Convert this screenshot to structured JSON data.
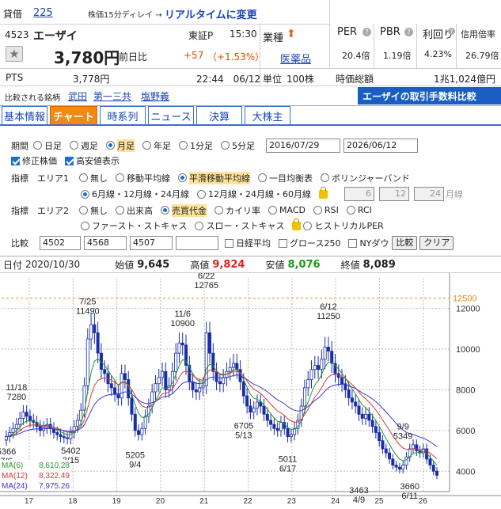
{
  "quote": {
    "lending_tag": "貸借",
    "lending_value": "225",
    "delay_note": "株価15分ディレイ →",
    "realtime_link": "リアルタイムに変更",
    "code": "4523",
    "name": "エーザイ",
    "market": "東証P",
    "time": "15:30",
    "price": "3,780円",
    "prev_label": "前日比",
    "change": "+57",
    "change_pct": "（+1.53%）",
    "pts_label": "PTS",
    "pts_price": "3,778円",
    "pts_datetime": "22:44　06/12",
    "compare_label": "比較される銘柄",
    "compare_1": "武田",
    "compare_2": "第一三共",
    "compare_3": "塩野義",
    "sector_label": "業種",
    "sector_value": "医薬品",
    "unit_label": "単位",
    "unit_value": "100株",
    "per_label": "PER",
    "per_value": "20.4倍",
    "pbr_label": "PBR",
    "pbr_value": "1.19倍",
    "yield_label": "利回り",
    "yield_value": "4.23%",
    "margin_label": "信用倍率",
    "margin_value": "26.79倍",
    "mcap_label": "時価総額",
    "mcap_value": "1兆1,024億円",
    "fee_banner": "エーザイの取引手数料比較"
  },
  "tabs": [
    "基本情報",
    "チャート",
    "時系列",
    "ニュース",
    "決算",
    "大株主"
  ],
  "form": {
    "period_label": "期間",
    "period_opts": [
      "日足",
      "週足",
      "月足",
      "年足",
      "1分足",
      "5分足"
    ],
    "period_selected": 2,
    "date_from": "2016/07/29",
    "date_to": "2026/06/12",
    "adjusted_label": "修正株価",
    "hires_label": "高安値表示",
    "ind1_label": "指標　エリア1",
    "ind1_opts": [
      "無し",
      "移動平均線",
      "平滑移動平均線",
      "一目均衡表",
      "ボリンジャーバンド"
    ],
    "ind1_selected": 2,
    "ma_opt1": "6月線・12月線・24月線",
    "ma_opt2": "12月線・24月線・60月線",
    "ma_custom": [
      "6",
      "12",
      "24"
    ],
    "ma_custom_unit": "月線",
    "ind2_label": "指標　エリア2",
    "ind2_opts": [
      "無し",
      "出来高",
      "売買代金",
      "カイリ率",
      "MACD",
      "RSI",
      "RCI"
    ],
    "ind2_selected": 2,
    "ind2_opts_b": [
      "ファースト・ストキャス",
      "スロー・ストキャス",
      "ヒストリカルPER"
    ],
    "cmp_label": "比較",
    "cmp_codes": [
      "4502",
      "4568",
      "4507",
      ""
    ],
    "cmp_nikkei": "日経平均",
    "cmp_growth": "グロース250",
    "cmp_nydow": "NYダウ",
    "btn_compare": "比較",
    "btn_clear": "クリア"
  },
  "ohlc": {
    "date_label": "日付",
    "date": "2020/10/30",
    "open_label": "始値",
    "open": "9,645",
    "high_label": "高値",
    "high": "9,824",
    "low_label": "安値",
    "low": "8,076",
    "close_label": "終値",
    "close": "8,089"
  },
  "chart_data": {
    "type": "candlestick",
    "ylim": [
      3000,
      13500
    ],
    "yticks": [
      4000,
      6000,
      8000,
      10000,
      12000
    ],
    "yline_label": "12500",
    "yline_value": 12500,
    "x_years": [
      "17",
      "18",
      "19",
      "20",
      "21",
      "22",
      "23",
      "24",
      "25",
      "26"
    ],
    "annotations": [
      {
        "t": 0,
        "v": 5366,
        "lines": [
          "5366",
          "7/6"
        ],
        "pos": "below"
      },
      {
        "t": 3,
        "v": 7280,
        "lines": [
          "11/18",
          "7280"
        ],
        "pos": "above"
      },
      {
        "t": 19,
        "v": 5402,
        "lines": [
          "5402",
          "2/15"
        ],
        "pos": "below"
      },
      {
        "t": 24,
        "v": 11490,
        "lines": [
          "7/25",
          "11490"
        ],
        "pos": "above"
      },
      {
        "t": 38,
        "v": 5205,
        "lines": [
          "5205",
          "9/4"
        ],
        "pos": "below"
      },
      {
        "t": 52,
        "v": 10900,
        "lines": [
          "11/6",
          "10900"
        ],
        "pos": "above"
      },
      {
        "t": 59,
        "v": 12765,
        "lines": [
          "6/22",
          "12765"
        ],
        "pos": "above"
      },
      {
        "t": 70,
        "v": 6705,
        "lines": [
          "6705",
          "5/13"
        ],
        "pos": "below2"
      },
      {
        "t": 83,
        "v": 5011,
        "lines": [
          "5011",
          "6/17"
        ],
        "pos": "below"
      },
      {
        "t": 95,
        "v": 11250,
        "lines": [
          "6/12",
          "11250"
        ],
        "pos": "above"
      },
      {
        "t": 117,
        "v": 5349,
        "lines": [
          "9/9",
          "5349"
        ],
        "pos": "above"
      },
      {
        "t": 104,
        "v": 3463,
        "lines": [
          "3463",
          "4/9"
        ],
        "pos": "below"
      },
      {
        "t": 119,
        "v": 3660,
        "lines": [
          "3660",
          "6/11"
        ],
        "pos": "below"
      }
    ],
    "legend": [
      {
        "name": "MA(6)",
        "value": "8,610.28",
        "color": "#2a9a2a"
      },
      {
        "name": "MA(12)",
        "value": "8,322.49",
        "color": "#d43a3a"
      },
      {
        "name": "MA(24)",
        "value": "7,975.26",
        "color": "#3a3ad4"
      }
    ],
    "candle_color": "#1a2ea8",
    "closes": [
      5700,
      5900,
      6100,
      6300,
      6600,
      6900,
      6700,
      6500,
      6400,
      6200,
      6000,
      6150,
      6300,
      6100,
      5900,
      5800,
      5700,
      5650,
      5600,
      5900,
      6200,
      6500,
      7000,
      8200,
      10500,
      11200,
      10800,
      9800,
      9000,
      8800,
      8300,
      8100,
      7800,
      7600,
      8800,
      8500,
      7600,
      6800,
      6000,
      5800,
      6100,
      6700,
      7200,
      7900,
      8300,
      8600,
      8900,
      8000,
      8200,
      8900,
      9800,
      10300,
      10200,
      9200,
      8400,
      8000,
      7900,
      8100,
      8200,
      10800,
      9800,
      8900,
      8400,
      8300,
      8600,
      8900,
      9100,
      9300,
      9000,
      8400,
      7700,
      7200,
      6900,
      7100,
      7400,
      7200,
      6800,
      6500,
      6300,
      6100,
      6000,
      6400,
      6100,
      5700,
      5800,
      6100,
      6500,
      7200,
      8100,
      8500,
      9000,
      9200,
      9000,
      9500,
      10100,
      9900,
      9300,
      8800,
      8600,
      8300,
      8000,
      7600,
      7400,
      7200,
      6800,
      6600,
      6800,
      6500,
      6200,
      5900,
      5500,
      5100,
      4900,
      4600,
      4300,
      4200,
      4100,
      4300,
      4700,
      5100,
      5300,
      5000,
      4900,
      5100,
      4600,
      4300,
      4000,
      3800
    ]
  }
}
